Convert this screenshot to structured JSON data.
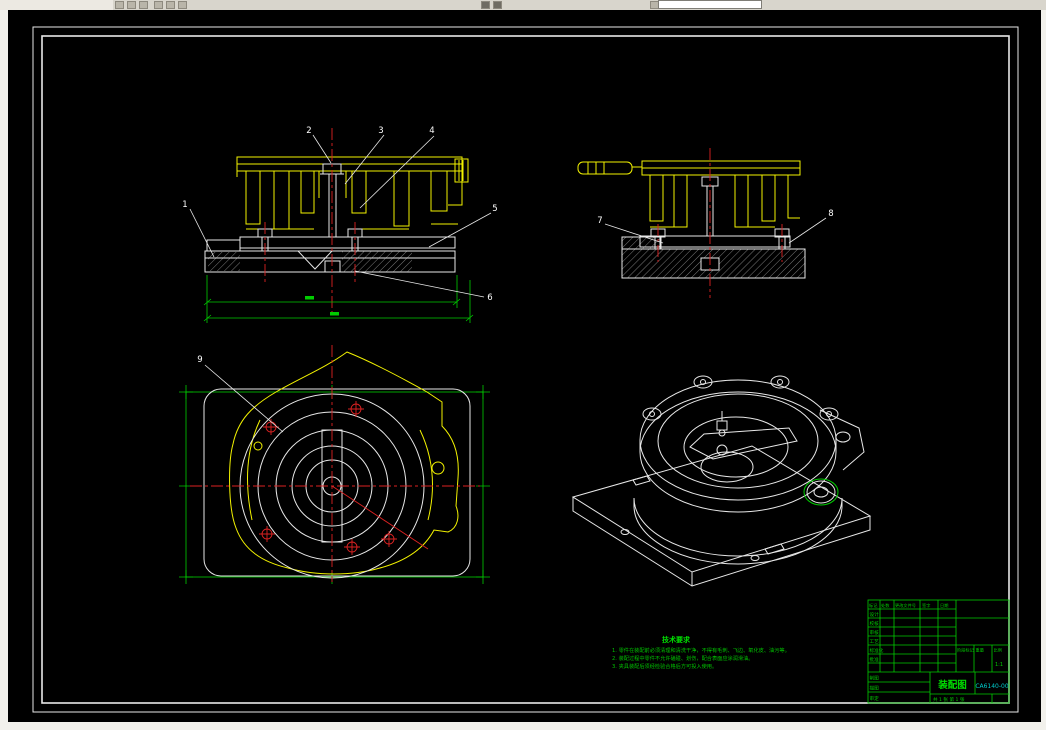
{
  "toolbar": {
    "combo_value": "",
    "icons": [
      "toolbar-icon-1",
      "toolbar-icon-2",
      "toolbar-icon-3",
      "toolbar-icon-4",
      "toolbar-icon-5",
      "toolbar-icon-6",
      "toolbar-icon-7",
      "toolbar-icon-8",
      "toolbar-icon-9"
    ]
  },
  "drawing": {
    "callouts": [
      "1",
      "2",
      "3",
      "4",
      "5",
      "6",
      "7",
      "8",
      "9"
    ],
    "notes": {
      "title": "技术要求",
      "lines": [
        "1. 零件在装配前必须清理和清洗干净，不得有毛刺、飞边、氧化皮、油污等。",
        "2. 装配过程中零件不允许磕碰、划伤，配合表面应涂润滑油。",
        "3. 夹具装配后须经检验合格后方可投入使用。"
      ]
    },
    "title_block": {
      "name": "装配图",
      "code": "CA6140-00",
      "header_cells": [
        "标记",
        "处数",
        "更改文件号",
        "签字",
        "日期"
      ],
      "sign_rows": [
        "设计",
        "校核",
        "审核",
        "工艺",
        "标准化",
        "批准"
      ],
      "stage_cells": [
        "阶段标记",
        "重量",
        "比例"
      ],
      "scale_value": "1:1",
      "bottom_rows": [
        "制图",
        "描图",
        "审定"
      ],
      "sheet_info": "共 1 张 第 1 张"
    }
  }
}
